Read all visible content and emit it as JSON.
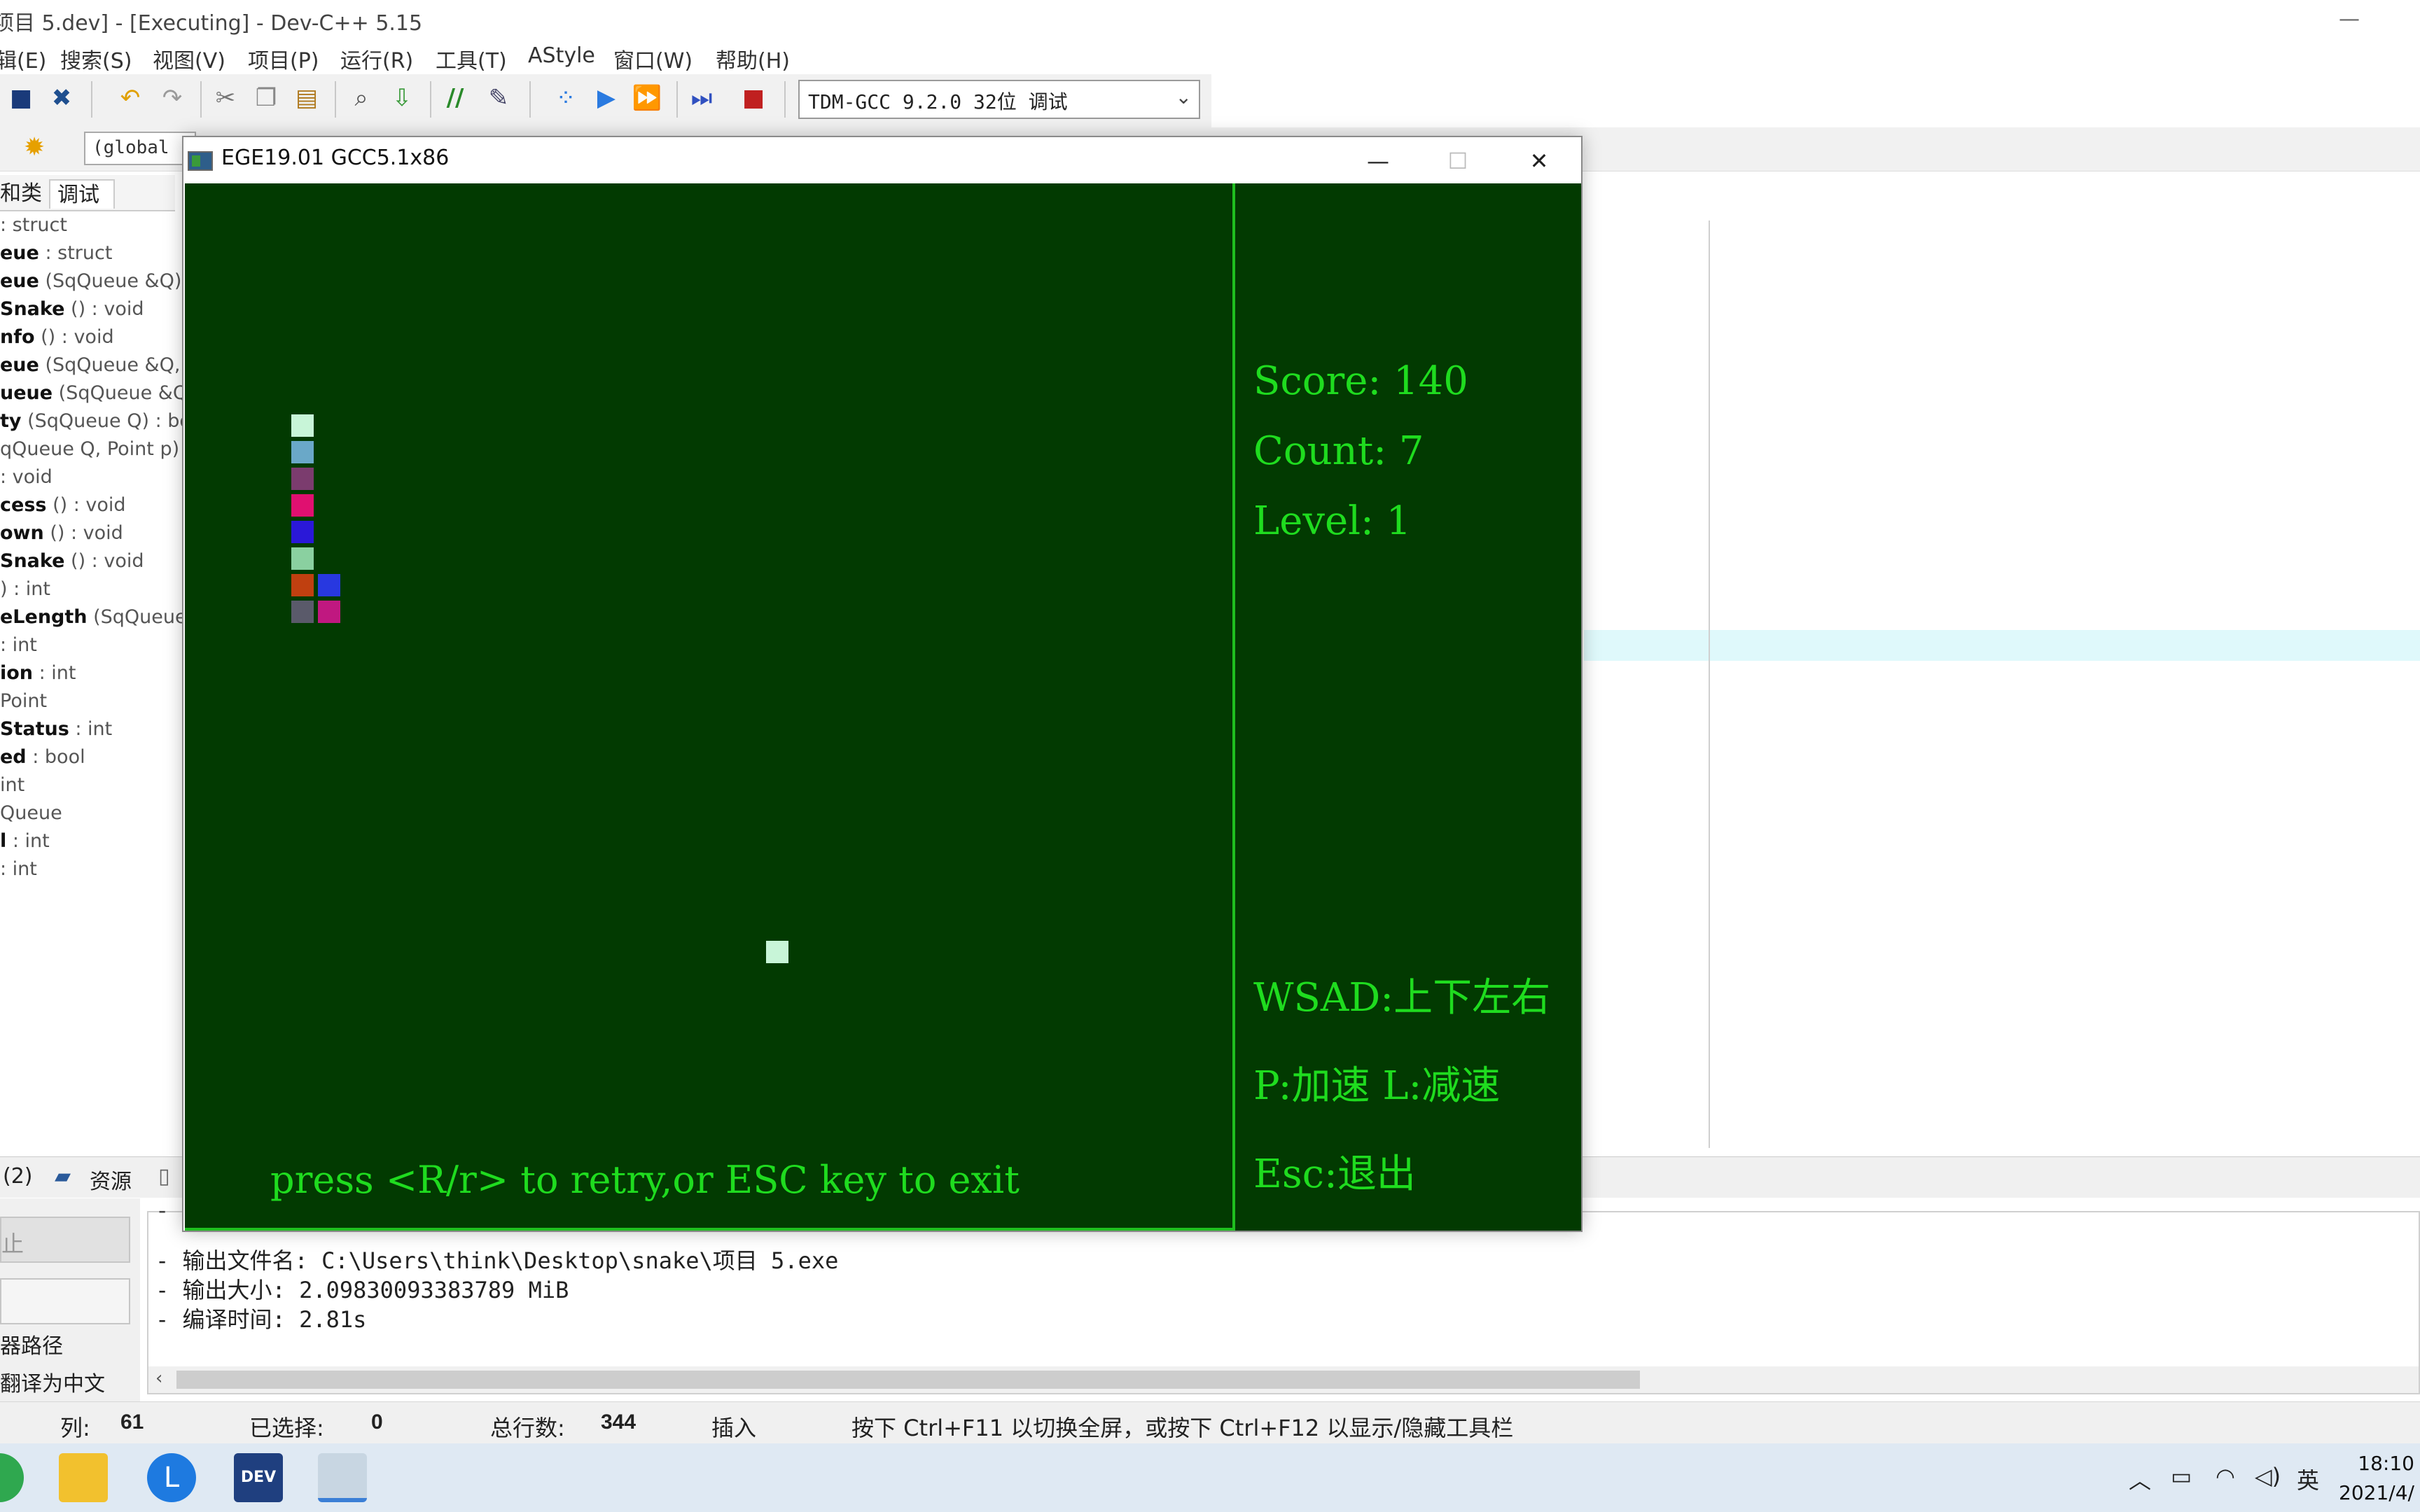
{
  "main_window": {
    "title": "项目 5.dev] - [Executing] - Dev-C++ 5.15",
    "minimize_glyph": "—"
  },
  "menu": [
    "辑(E)",
    "搜索(S)",
    "视图(V)",
    "项目(P)",
    "运行(R)",
    "工具(T)",
    "AStyle",
    "窗口(W)",
    "帮助(H)"
  ],
  "toolbar": {
    "compiler_select": "TDM-GCC 9.2.0 32位 调试",
    "scope_select": "(global"
  },
  "left_panel": {
    "tabs": [
      "和类",
      "调试"
    ],
    "classes": [
      {
        "name": "",
        "type": ": struct"
      },
      {
        "name": "eue",
        "type": ": struct"
      },
      {
        "name": "eue",
        "type": "(SqQueue &Q) :"
      },
      {
        "name": "Snake",
        "type": "() : void"
      },
      {
        "name": "nfo",
        "type": "() : void"
      },
      {
        "name": "eue",
        "type": "(SqQueue &Q, Po"
      },
      {
        "name": "ueue",
        "type": "(SqQueue &Q) :"
      },
      {
        "name": "ty",
        "type": "(SqQueue Q) : boo"
      },
      {
        "name": "",
        "type": "qQueue Q, Point p) :"
      },
      {
        "name": "",
        "type": ": void"
      },
      {
        "name": "cess",
        "type": "() : void"
      },
      {
        "name": "own",
        "type": "() : void"
      },
      {
        "name": "Snake",
        "type": "() : void"
      },
      {
        "name": "",
        "type": ") : int"
      },
      {
        "name": "eLength",
        "type": "(SqQueue Q"
      },
      {
        "name": "",
        "type": ": int"
      },
      {
        "name": "ion",
        "type": ": int"
      },
      {
        "name": "",
        "type": "Point"
      },
      {
        "name": "Status",
        "type": ": int"
      },
      {
        "name": "ed",
        "type": ": bool"
      },
      {
        "name": "",
        "type": "int"
      },
      {
        "name": "",
        "type": "Queue"
      },
      {
        "name": "l",
        "type": ": int"
      },
      {
        "name": "",
        "type": ": int"
      }
    ]
  },
  "bottom_panel": {
    "tabs": [
      "(2)",
      "资源"
    ],
    "stop_button": "止",
    "left_items": [
      "器路径",
      "翻译为中文"
    ],
    "output_lines": [
      "- 输出文件名: C:\\Users\\think\\Desktop\\snake\\项目 5.exe",
      "- 输出大小: 2.09830093383789 MiB",
      "- 编译时间: 2.81s"
    ],
    "output_top_fragment": "- ■■■■"
  },
  "statusbar": {
    "col_label": "列:",
    "col_value": "61",
    "selected_label": "已选择:",
    "selected_value": "0",
    "lines_label": "总行数:",
    "lines_value": "344",
    "mode": "插入",
    "hint": "按下 Ctrl+F11 以切换全屏，或按下 Ctrl+F12 以显示/隐藏工具栏"
  },
  "taskbar": {
    "ime": "英",
    "time": "18:10",
    "date": "2021/4/"
  },
  "game_window": {
    "title": "EGE19.01 GCC5.1x86",
    "score": "Score: 140",
    "count": "Count: 7",
    "level": "Level: 1",
    "help_move": "WSAD:上下左右",
    "help_speed": "P:加速 L:减速",
    "help_exit": "Esc:退出",
    "prompt": "press <R/r> to retry,or ESC key to exit",
    "canvas_color": "#023a01",
    "text_color": "#1fdc1f",
    "snake_cells": [
      {
        "col": 0,
        "row": 0,
        "color": "#c8f5d8"
      },
      {
        "col": 0,
        "row": 1,
        "color": "#6aa8c8"
      },
      {
        "col": 0,
        "row": 2,
        "color": "#7b3c6e"
      },
      {
        "col": 0,
        "row": 3,
        "color": "#e01070"
      },
      {
        "col": 0,
        "row": 4,
        "color": "#2a18d8"
      },
      {
        "col": 0,
        "row": 5,
        "color": "#8ad0a0"
      },
      {
        "col": 0,
        "row": 6,
        "color": "#c04010"
      },
      {
        "col": 1,
        "row": 6,
        "color": "#2838e0"
      },
      {
        "col": 0,
        "row": 7,
        "color": "#5a5a6a"
      },
      {
        "col": 1,
        "row": 7,
        "color": "#c01880"
      }
    ],
    "food_color": "#c8f5d8"
  }
}
